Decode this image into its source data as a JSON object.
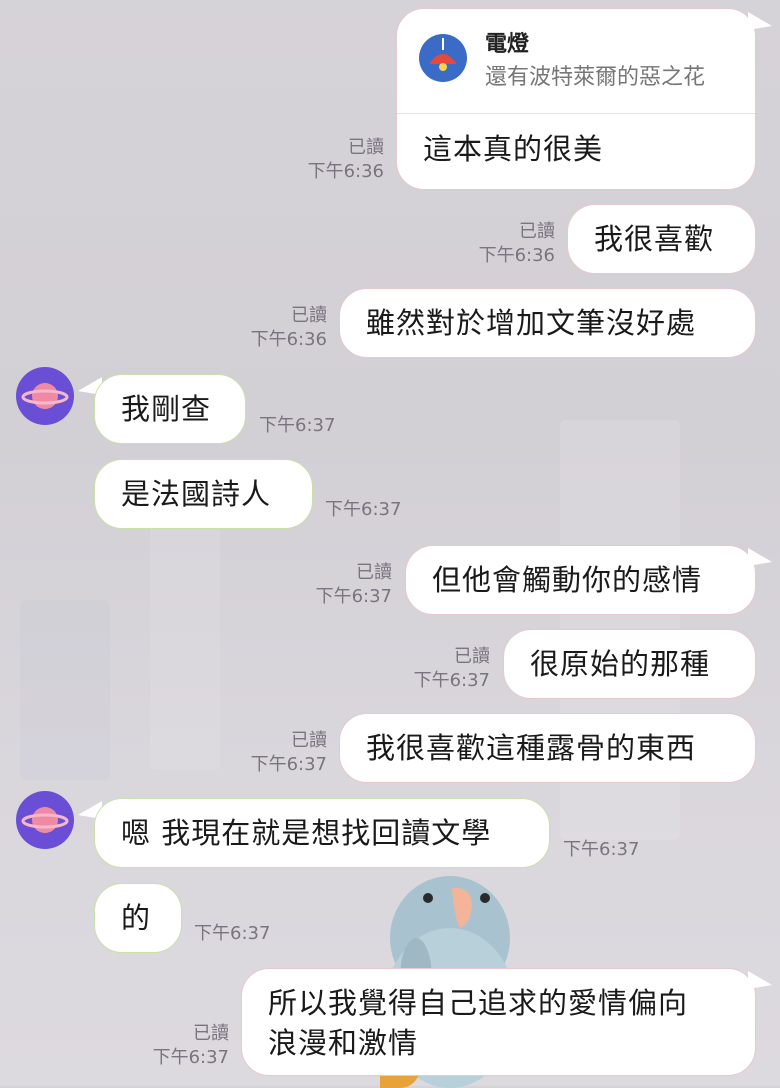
{
  "shared_card": {
    "icon": "lamp-icon",
    "title": "電燈",
    "subtitle": "還有波特萊爾的惡之花",
    "message": "這本真的很美",
    "read": "已讀",
    "time": "下午6:36"
  },
  "messages": [
    {
      "side": "out",
      "text": "我很喜歡",
      "read": "已讀",
      "time": "下午6:36"
    },
    {
      "side": "out",
      "text": "雖然對於增加文筆沒好處",
      "read": "已讀",
      "time": "下午6:36"
    },
    {
      "side": "in",
      "text": "我剛查",
      "time": "下午6:37",
      "avatar": "planet-icon"
    },
    {
      "side": "in",
      "text": "是法國詩人",
      "time": "下午6:37"
    },
    {
      "side": "out",
      "text": "但他會觸動你的感情",
      "read": "已讀",
      "time": "下午6:37"
    },
    {
      "side": "out",
      "text": "很原始的那種",
      "read": "已讀",
      "time": "下午6:37"
    },
    {
      "side": "out",
      "text": "我很喜歡這種露骨的東西",
      "read": "已讀",
      "time": "下午6:37"
    },
    {
      "side": "in",
      "text": "嗯 我現在就是想找回讀文學",
      "time": "下午6:37",
      "avatar": "planet-icon"
    },
    {
      "side": "in",
      "text": "的",
      "time": "下午6:37"
    },
    {
      "side": "out",
      "text_line1": "所以我覺得自己追求的愛情偏向",
      "text_line2": "浪漫和激情",
      "read": "已讀",
      "time": "下午6:37"
    }
  ],
  "colors": {
    "background": "#d4d1d7",
    "outgoing_border": "#e7c8cd",
    "incoming_border": "#c9e0a8",
    "avatar": "#6a4fd6",
    "card_icon": "#3a6bc6",
    "meta_text": "#7a7480"
  }
}
